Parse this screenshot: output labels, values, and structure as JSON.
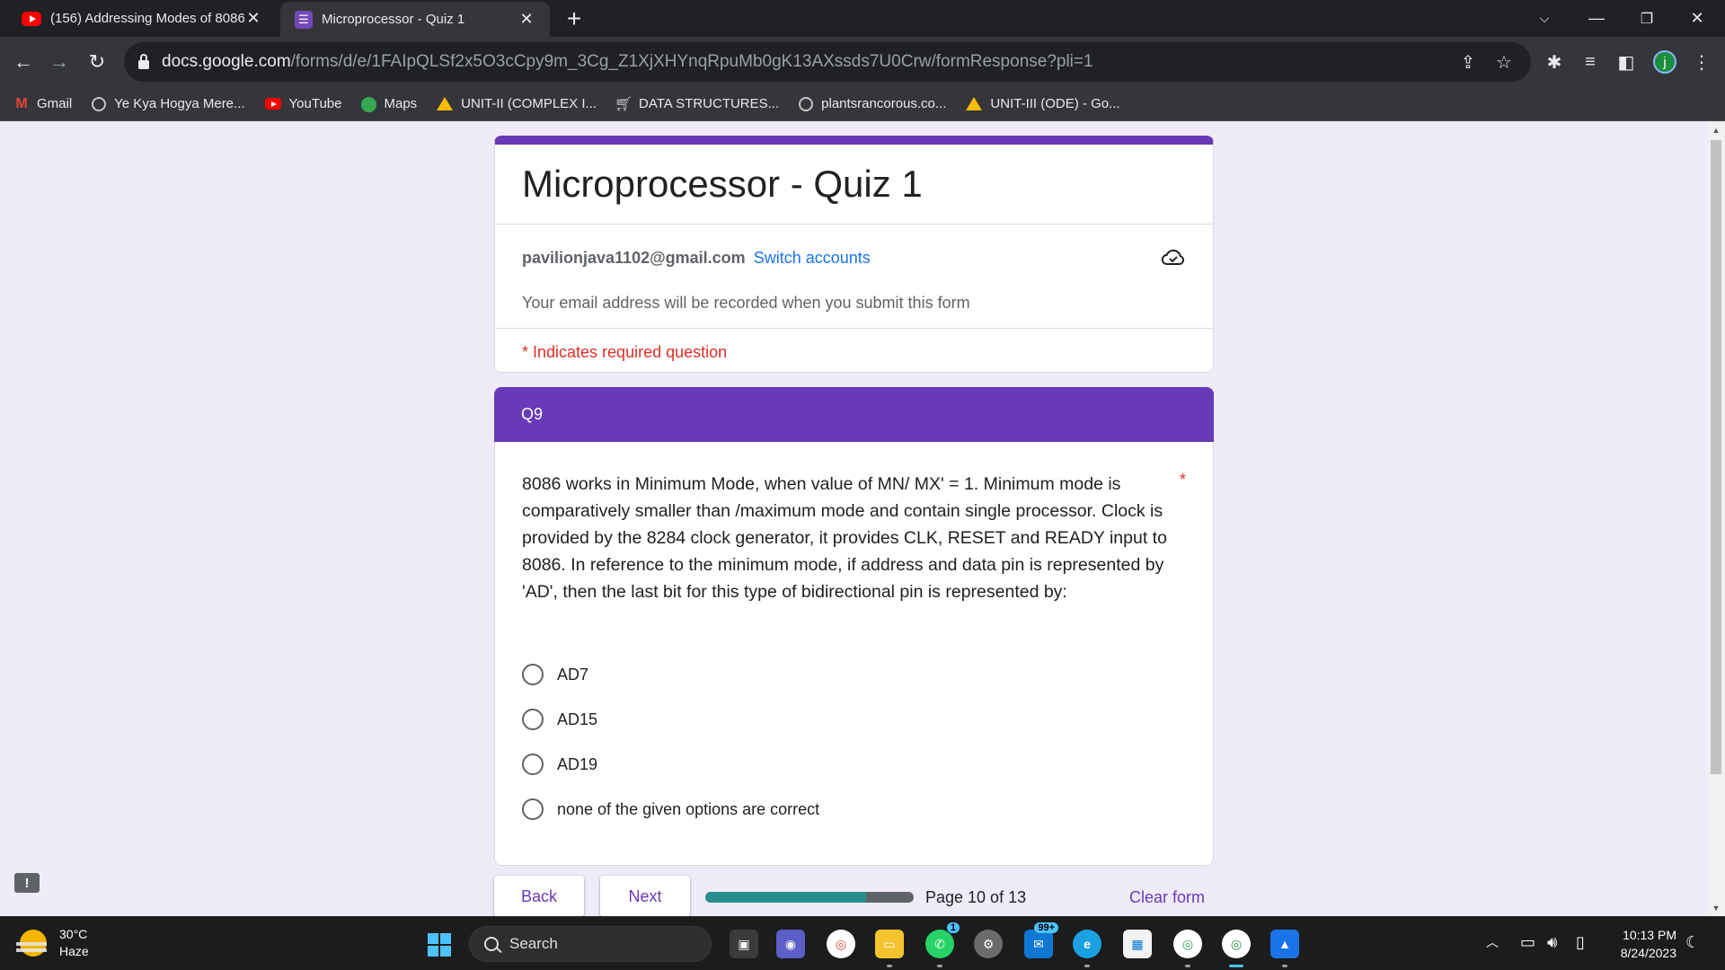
{
  "browser": {
    "tabs": [
      {
        "title": "(156) Addressing Modes of 8086",
        "favicon": "youtube-icon"
      },
      {
        "title": "Microprocessor - Quiz 1",
        "favicon": "google-forms-icon"
      }
    ],
    "url_host": "docs.google.com",
    "url_path": "/forms/d/e/1FAIpQLSf2x5O3cCpy9m_3Cg_Z1XjXHYnqRpuMb0gK13AXssds7U0Crw/formResponse?pli=1",
    "profile_initial": "j",
    "bookmarks": [
      {
        "label": "Gmail",
        "icon": "gmail-icon"
      },
      {
        "label": "Ye Kya Hogya Mere...",
        "icon": "globe-icon"
      },
      {
        "label": "YouTube",
        "icon": "youtube-icon"
      },
      {
        "label": "Maps",
        "icon": "maps-icon"
      },
      {
        "label": "UNIT-II (COMPLEX I...",
        "icon": "drive-icon"
      },
      {
        "label": "DATA STRUCTURES...",
        "icon": "cart-icon"
      },
      {
        "label": "plantsrancorous.co...",
        "icon": "globe-icon"
      },
      {
        "label": "UNIT-III (ODE) - Go...",
        "icon": "drive-icon"
      }
    ]
  },
  "form": {
    "title": "Microprocessor - Quiz 1",
    "account_email": "pavilionjava1102@gmail.com",
    "switch_accounts": "Switch accounts",
    "email_note": "Your email address will be recorded when you submit this form",
    "required_note": "* Indicates required question",
    "section_title": "Q9",
    "question": {
      "text": "8086 works in Minimum Mode, when value of MN/ MX' = 1. Minimum mode is comparatively smaller than /maximum mode and contain single processor. Clock is provided by the 8284 clock generator, it provides CLK, RESET and READY input to 8086. In reference to the minimum mode, if address and data pin is represented by 'AD', then the last bit for this type of bidirectional pin is represented by:",
      "required_marker": "*",
      "options": [
        "AD7",
        "AD15",
        "AD19",
        "none of the given options are correct"
      ]
    },
    "nav": {
      "back": "Back",
      "next": "Next",
      "page_indicator": "Page 10 of 13",
      "progress_fraction": 0.77,
      "clear": "Clear form"
    },
    "colors": {
      "accent": "#673ab7",
      "background": "#f0ebf8",
      "progress": "#268f8e",
      "required": "#d93025",
      "link": "#1a73e8"
    }
  },
  "taskbar": {
    "weather_temp": "30°C",
    "weather_condition": "Haze",
    "search_label": "Search",
    "mail_badge": "99+",
    "whatsapp_badge": "1",
    "time": "10:13 PM",
    "date": "8/24/2023"
  }
}
